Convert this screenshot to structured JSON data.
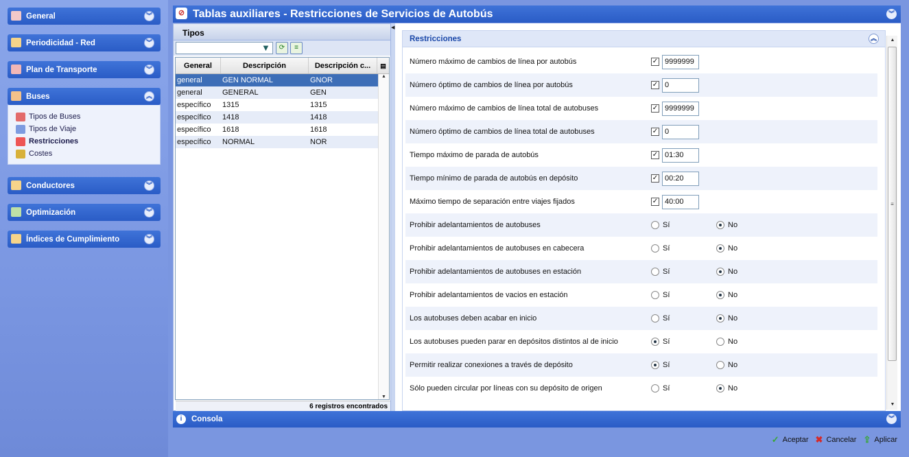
{
  "sidebar": {
    "groups": [
      {
        "label": "General",
        "icon": "general-icon"
      },
      {
        "label": "Periodicidad - Red",
        "icon": "route-icon"
      },
      {
        "label": "Plan de Transporte",
        "icon": "transport-plan-icon"
      },
      {
        "label": "Buses",
        "icon": "bus-icon",
        "items": [
          {
            "label": "Tipos de Buses",
            "icon": "bus-type-icon"
          },
          {
            "label": "Tipos de Viaje",
            "icon": "trip-type-icon"
          },
          {
            "label": "Restricciones",
            "icon": "restriction-icon"
          },
          {
            "label": "Costes",
            "icon": "costs-icon"
          }
        ]
      },
      {
        "label": "Conductores",
        "icon": "driver-icon"
      },
      {
        "label": "Optimización",
        "icon": "optimization-icon"
      },
      {
        "label": "Índices de Cumplimiento",
        "icon": "compliance-icon"
      }
    ]
  },
  "window": {
    "title": "Tablas auxiliares - Restricciones de Servicios de Autobús"
  },
  "tipos": {
    "title": "Tipos",
    "search_value": "",
    "columns": [
      "General",
      "Descripción",
      "Descripción c..."
    ],
    "rows": [
      [
        "general",
        "GEN NORMAL",
        "GNOR"
      ],
      [
        "general",
        "GENERAL",
        "GEN"
      ],
      [
        "específico",
        "1315",
        "1315"
      ],
      [
        "específico",
        "1418",
        "1418"
      ],
      [
        "específico",
        "1618",
        "1618"
      ],
      [
        "específico",
        "NORMAL",
        "NOR"
      ]
    ],
    "footer": "6 registros encontrados"
  },
  "restricciones": {
    "title": "Restricciones",
    "yes_label": "Sí",
    "no_label": "No",
    "value_rows": [
      {
        "label": "Número máximo de cambios de línea por autobús",
        "checked": true,
        "value": "9999999"
      },
      {
        "label": "Número óptimo de cambios de línea por autobús",
        "checked": true,
        "value": "0"
      },
      {
        "label": "Número máximo de cambios de línea total de autobuses",
        "checked": true,
        "value": "9999999"
      },
      {
        "label": "Número óptimo de cambios de línea total de autobuses",
        "checked": true,
        "value": "0"
      },
      {
        "label": "Tiempo máximo de parada de autobús",
        "checked": true,
        "value": "01:30"
      },
      {
        "label": "Tiempo mínimo de parada de autobús en depósito",
        "checked": true,
        "value": "00:20"
      },
      {
        "label": "Máximo tiempo de separación entre viajes fijados",
        "checked": true,
        "value": "40:00"
      }
    ],
    "radio_rows": [
      {
        "label": "Prohibir adelantamientos de autobuses",
        "selected": "No"
      },
      {
        "label": "Prohibir adelantamientos de autobuses en cabecera",
        "selected": "No"
      },
      {
        "label": "Prohibir adelantamientos de autobuses en estación",
        "selected": "No"
      },
      {
        "label": "Prohibir adelantamientos de vacios en estación",
        "selected": "No"
      },
      {
        "label": "Los autobuses deben acabar en inicio",
        "selected": "No"
      },
      {
        "label": "Los autobuses pueden parar en depósitos distintos al de inicio",
        "selected": "Sí"
      },
      {
        "label": "Permitir realizar conexiones a través de depósito",
        "selected": "Sí"
      },
      {
        "label": "Sólo pueden circular por líneas con su depósito de origen",
        "selected": "No"
      }
    ]
  },
  "console": {
    "label": "Consola"
  },
  "actions": {
    "accept": "Aceptar",
    "cancel": "Cancelar",
    "apply": "Aplicar"
  },
  "colors": {
    "header_blue": "#2a5cc6",
    "selected_row": "#3d6eb7",
    "sidebar_bg": "#7b97e2"
  }
}
